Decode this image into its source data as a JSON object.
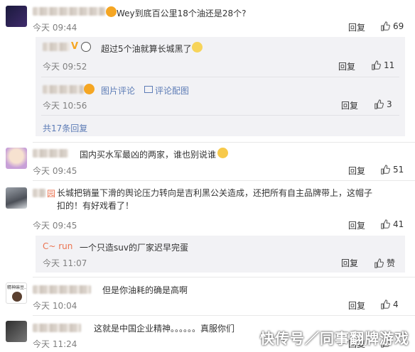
{
  "comments": [
    {
      "text": "Wey到底百公里18个油还是28个?",
      "time": "今天 09:44",
      "reply_label": "回复",
      "likes": "69",
      "replies": [
        {
          "text": "超过5个油就算长城黑了",
          "time": "今天 09:52",
          "reply_label": "回复",
          "likes": "11"
        },
        {
          "text": "图片评论",
          "extra": "评论配图",
          "time": "今天 10:56",
          "reply_label": "回复",
          "likes": "3"
        }
      ],
      "more_replies": "共17条回复"
    },
    {
      "text": "国内买水军最凶的两家，谁也别说谁",
      "time": "今天 09:45",
      "reply_label": "回复",
      "likes": "51"
    },
    {
      "name_suffix": "园",
      "text": "长城把销量下滑的舆论压力转向是吉利黑公关造成，还把所有自主品牌带上，这帽子扣的！有好戏看了！",
      "time": "今天 09:45",
      "reply_label": "回复",
      "likes": "41",
      "replies": [
        {
          "name": "C~ run",
          "text": "一个只造suv的厂家迟早完蛋",
          "time": "今天 11:07",
          "reply_label": "回复",
          "likes": "赞"
        }
      ]
    },
    {
      "avatar_text": "精神麻豆…",
      "text": "但是你油耗的确是高啊",
      "time": "今天 10:04",
      "reply_label": "回复",
      "likes": "4"
    },
    {
      "text": "这就是中国企业精神。。。。。。真服你们",
      "time": "今天 11:24",
      "reply_label": "回复",
      "likes": ""
    }
  ],
  "watermark": "快传号／同事翻牌游戏",
  "colors": {
    "link": "#eb7350",
    "blue": "#5d7cb6",
    "subbox": "#f2f2f5",
    "time": "#808080"
  }
}
